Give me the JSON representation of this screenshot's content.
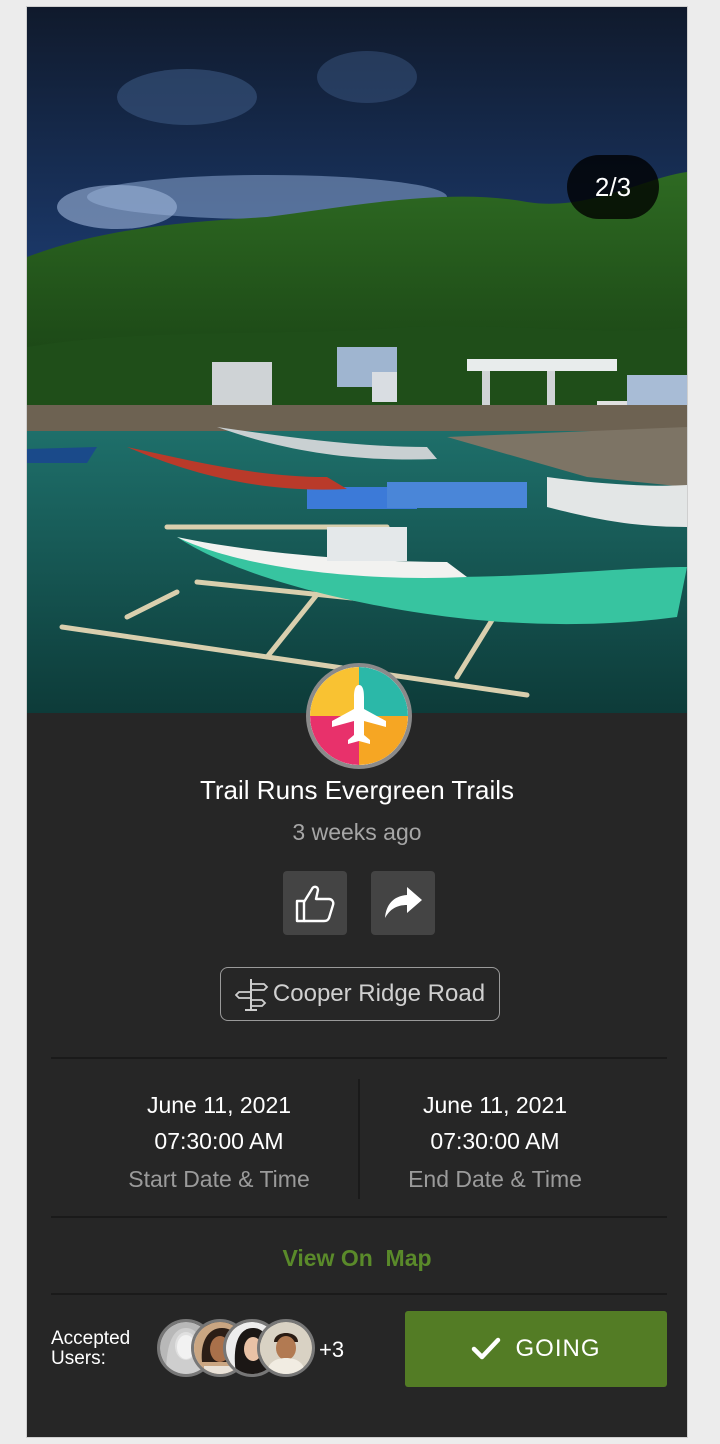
{
  "slider": {
    "counter": "2/3"
  },
  "event": {
    "title": "Trail Runs Evergreen Trails",
    "posted": "3 weeks ago",
    "location": "Cooper Ridge Road"
  },
  "actions": {
    "like_icon": "thumbs-up-icon",
    "share_icon": "share-arrow-icon"
  },
  "schedule": {
    "start": {
      "date": "June 11, 2021",
      "time": "07:30:00 AM",
      "label": "Start Date & Time"
    },
    "end": {
      "date": "June 11, 2021",
      "time": "07:30:00 AM",
      "label": "End Date & Time"
    }
  },
  "map_link": "View On  Map",
  "accepted": {
    "label_line1": "Accepted",
    "label_line2": "Users:",
    "more": "+3"
  },
  "going_button": {
    "label": "GOING",
    "color": "#537c25"
  },
  "colors": {
    "card_bg": "#262626",
    "accent_green": "#5a8a2a"
  }
}
